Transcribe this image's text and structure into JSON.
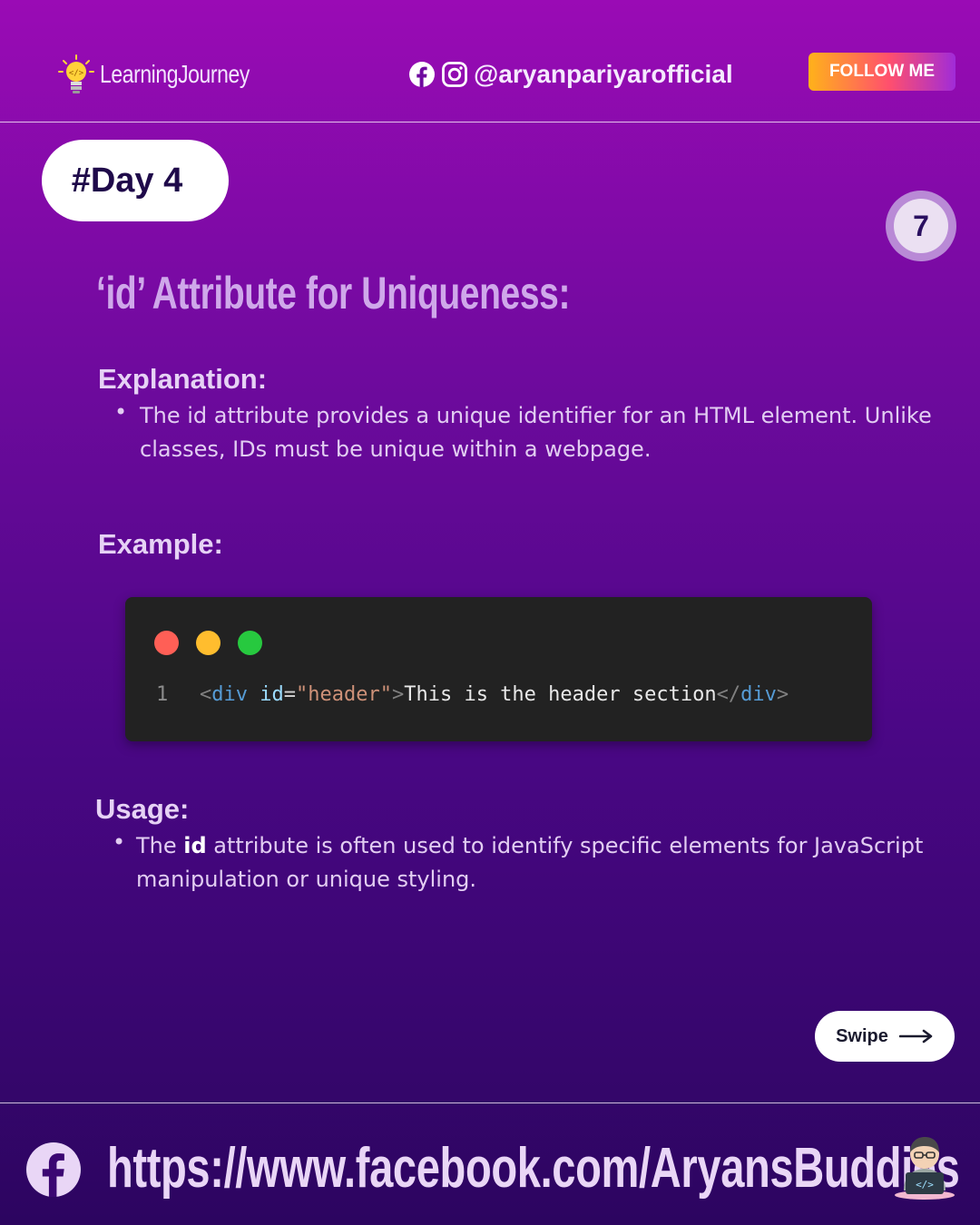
{
  "header": {
    "brand": "LearningJourney",
    "handle": "@aryanpariyarofficial",
    "follow_label": "FOLLOW ME",
    "social_icons": [
      "facebook-icon",
      "instagram-icon"
    ]
  },
  "slide": {
    "day_label": "#Day 4",
    "page_number": "7",
    "title": "‘id’ Attribute for Uniqueness:"
  },
  "explanation": {
    "heading": "Explanation:",
    "bullet": "The id attribute provides a unique identifier for an HTML element. Unlike classes, IDs must be unique within a webpage."
  },
  "example": {
    "heading": "Example:",
    "window_dots": [
      "#ff5f56",
      "#ffbd2e",
      "#27c93f"
    ],
    "line_number": "1",
    "code": {
      "open_tag_start": "<",
      "tag": "div",
      "attr": "id",
      "equals": "=",
      "value": "\"header\"",
      "open_tag_end": ">",
      "text": "This is the header section",
      "close_tag_start": "</",
      "close_tag": "div",
      "close_tag_end": ">"
    }
  },
  "usage": {
    "heading": "Usage:",
    "bullet_pre": "The ",
    "bullet_bold": "id",
    "bullet_post": " attribute is often used to identify specific elements for JavaScript manipulation or unique styling."
  },
  "swipe_label": "Swipe",
  "footer": {
    "url": "https://www.facebook.com/AryansBuddies"
  },
  "colors": {
    "accent_title": "#cfa8ea",
    "code_bg": "#222222",
    "code_tag": "#569cd6",
    "code_attr": "#9cdcfe",
    "code_string": "#ce9178"
  }
}
